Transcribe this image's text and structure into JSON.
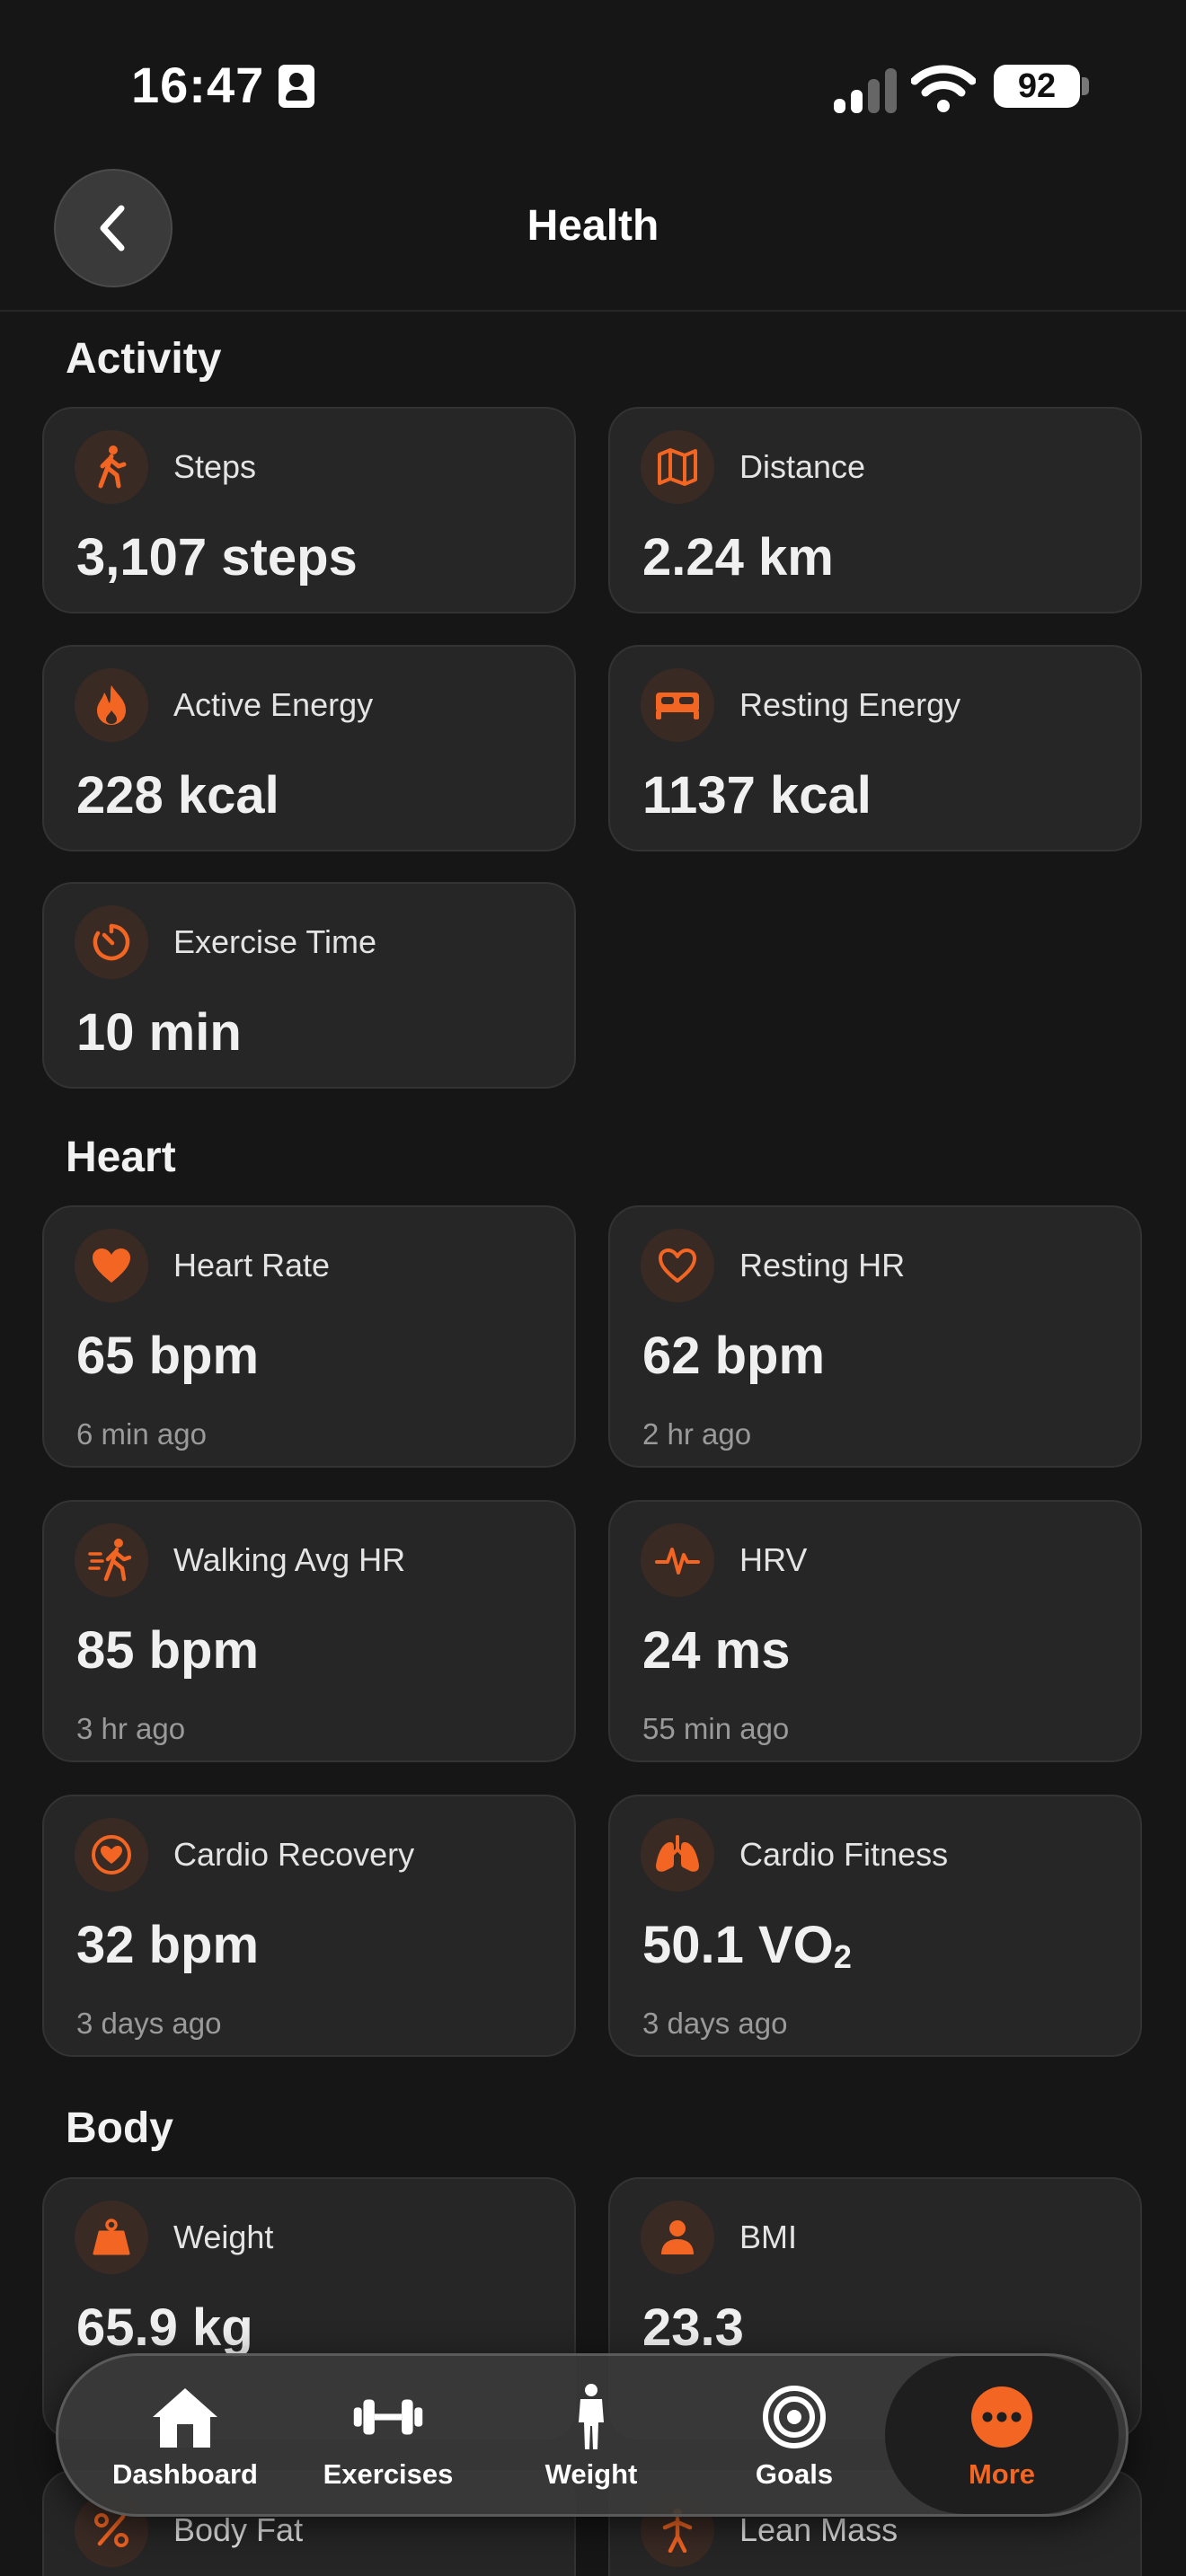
{
  "status": {
    "time": "16:47",
    "battery": "92"
  },
  "nav": {
    "title": "Health"
  },
  "colors": {
    "accent": "#f26522",
    "background": "#161616",
    "card": "#262626"
  },
  "sections": {
    "activity": "Activity",
    "heart": "Heart",
    "body": "Body"
  },
  "activity": {
    "steps": {
      "label": "Steps",
      "value": "3,107 steps"
    },
    "distance": {
      "label": "Distance",
      "value": "2.24 km"
    },
    "active_energy": {
      "label": "Active Energy",
      "value": "228 kcal"
    },
    "resting_energy": {
      "label": "Resting Energy",
      "value": "1137 kcal"
    },
    "exercise_time": {
      "label": "Exercise Time",
      "value": "10 min"
    }
  },
  "heart": {
    "heart_rate": {
      "label": "Heart Rate",
      "value": "65 bpm",
      "updated": "6 min ago"
    },
    "resting_hr": {
      "label": "Resting HR",
      "value": "62 bpm",
      "updated": "2 hr ago"
    },
    "walking_avg_hr": {
      "label": "Walking Avg HR",
      "value": "85 bpm",
      "updated": "3 hr ago"
    },
    "hrv": {
      "label": "HRV",
      "value": "24 ms",
      "updated": "55 min ago"
    },
    "cardio_recovery": {
      "label": "Cardio Recovery",
      "value": "32 bpm",
      "updated": "3 days ago"
    },
    "cardio_fitness": {
      "label": "Cardio Fitness",
      "value": "50.1 VO",
      "value_sub": "2",
      "updated": "3 days ago"
    }
  },
  "body": {
    "weight": {
      "label": "Weight",
      "value": "65.9 kg"
    },
    "bmi": {
      "label": "BMI",
      "value": "23.3"
    },
    "body_fat": {
      "label": "Body Fat"
    },
    "lean_mass": {
      "label": "Lean Mass"
    }
  },
  "tabs": [
    {
      "label": "Dashboard",
      "icon": "house-icon"
    },
    {
      "label": "Exercises",
      "icon": "dumbbell-icon"
    },
    {
      "label": "Weight",
      "icon": "person-icon"
    },
    {
      "label": "Goals",
      "icon": "target-icon"
    },
    {
      "label": "More",
      "icon": "ellipsis-circle-icon"
    }
  ]
}
